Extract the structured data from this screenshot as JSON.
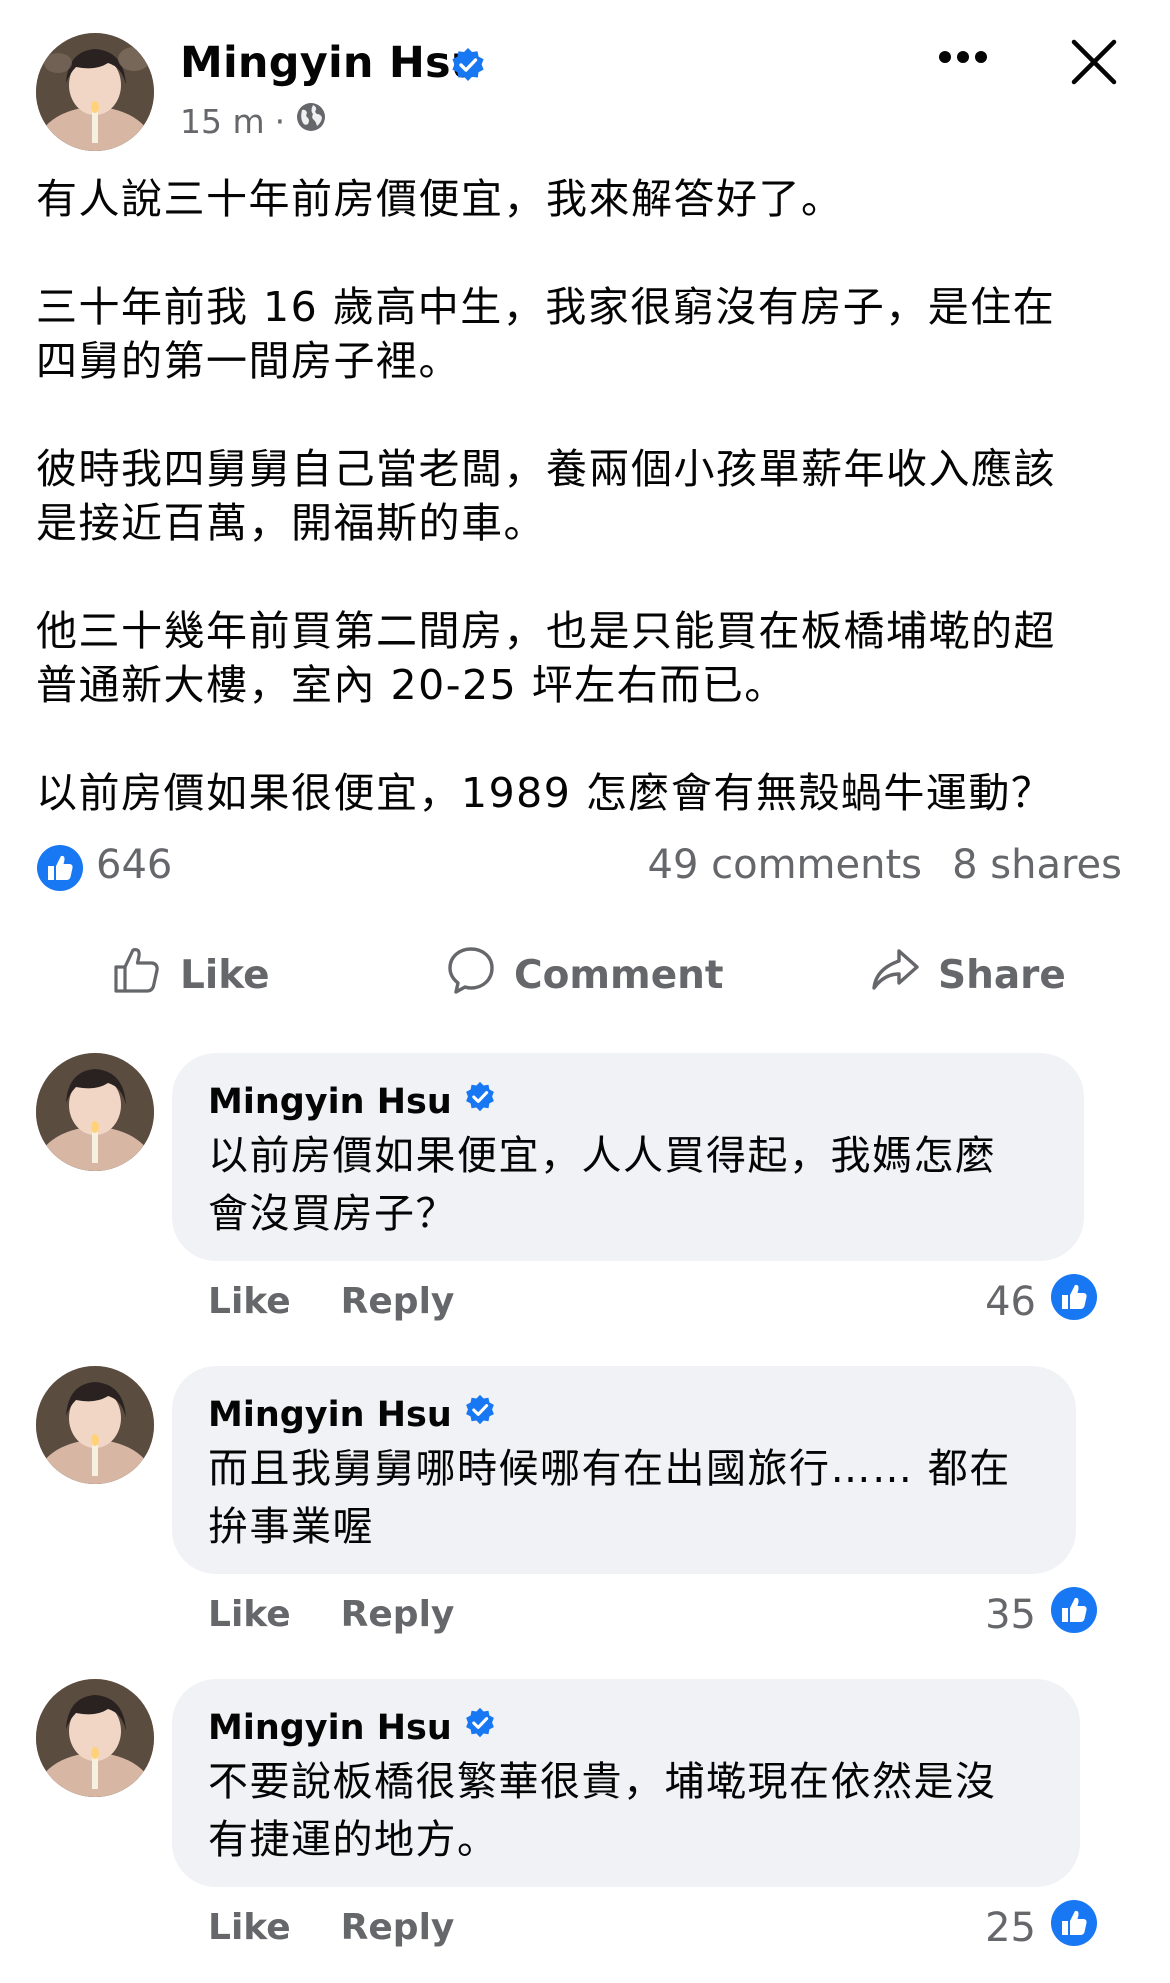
{
  "post": {
    "author": "Mingyin Hsu",
    "time": "15 m",
    "separator": "·",
    "paragraphs": [
      [
        "有人說三十年前房價便宜，我來解答好了。"
      ],
      [
        "三十年前我 16 歲高中生，我家很窮沒有房子，是住在",
        "四舅的第一間房子裡。"
      ],
      [
        "彼時我四舅舅自己當老闆，養兩個小孩單薪年收入應該",
        "是接近百萬，開福斯的車。"
      ],
      [
        "他三十幾年前買第二間房，也是只能買在板橋埔墘的超",
        "普通新大樓，室內 20-25 坪左右而已。"
      ],
      [
        "以前房價如果很便宜，1989 怎麼會有無殼蝸牛運動？"
      ]
    ]
  },
  "stats": {
    "likes": "646",
    "comments": "49 comments",
    "shares": "8 shares"
  },
  "actions": {
    "like": "Like",
    "comment": "Comment",
    "share": "Share"
  },
  "comments": [
    {
      "author": "Mingyin Hsu",
      "lines": [
        "以前房價如果便宜，人人買得起，我媽怎麼",
        "會沒買房子？"
      ],
      "like": "Like",
      "reply": "Reply",
      "reactions": "46"
    },
    {
      "author": "Mingyin Hsu",
      "lines": [
        "而且我舅舅哪時候哪有在出國旅行…… 都在",
        "拚事業喔"
      ],
      "like": "Like",
      "reply": "Reply",
      "reactions": "35"
    },
    {
      "author": "Mingyin Hsu",
      "lines": [
        "不要說板橋很繁華很貴，埔墘現在依然是沒",
        "有捷運的地方。"
      ],
      "like": "Like",
      "reply": "Reply",
      "reactions": "25"
    }
  ],
  "icons": {
    "verified": "verified-badge-icon",
    "privacy": "globe-icon",
    "more": "more-dots-icon",
    "close": "close-icon",
    "like_badge": "thumbs-up-badge-icon",
    "like_action": "thumbs-up-outline-icon",
    "comment_action": "speech-bubble-icon",
    "share_action": "share-arrow-icon"
  },
  "colors": {
    "accent": "#1877f2",
    "secondary_text": "#65676b",
    "bubble_bg": "#f0f2f5"
  }
}
